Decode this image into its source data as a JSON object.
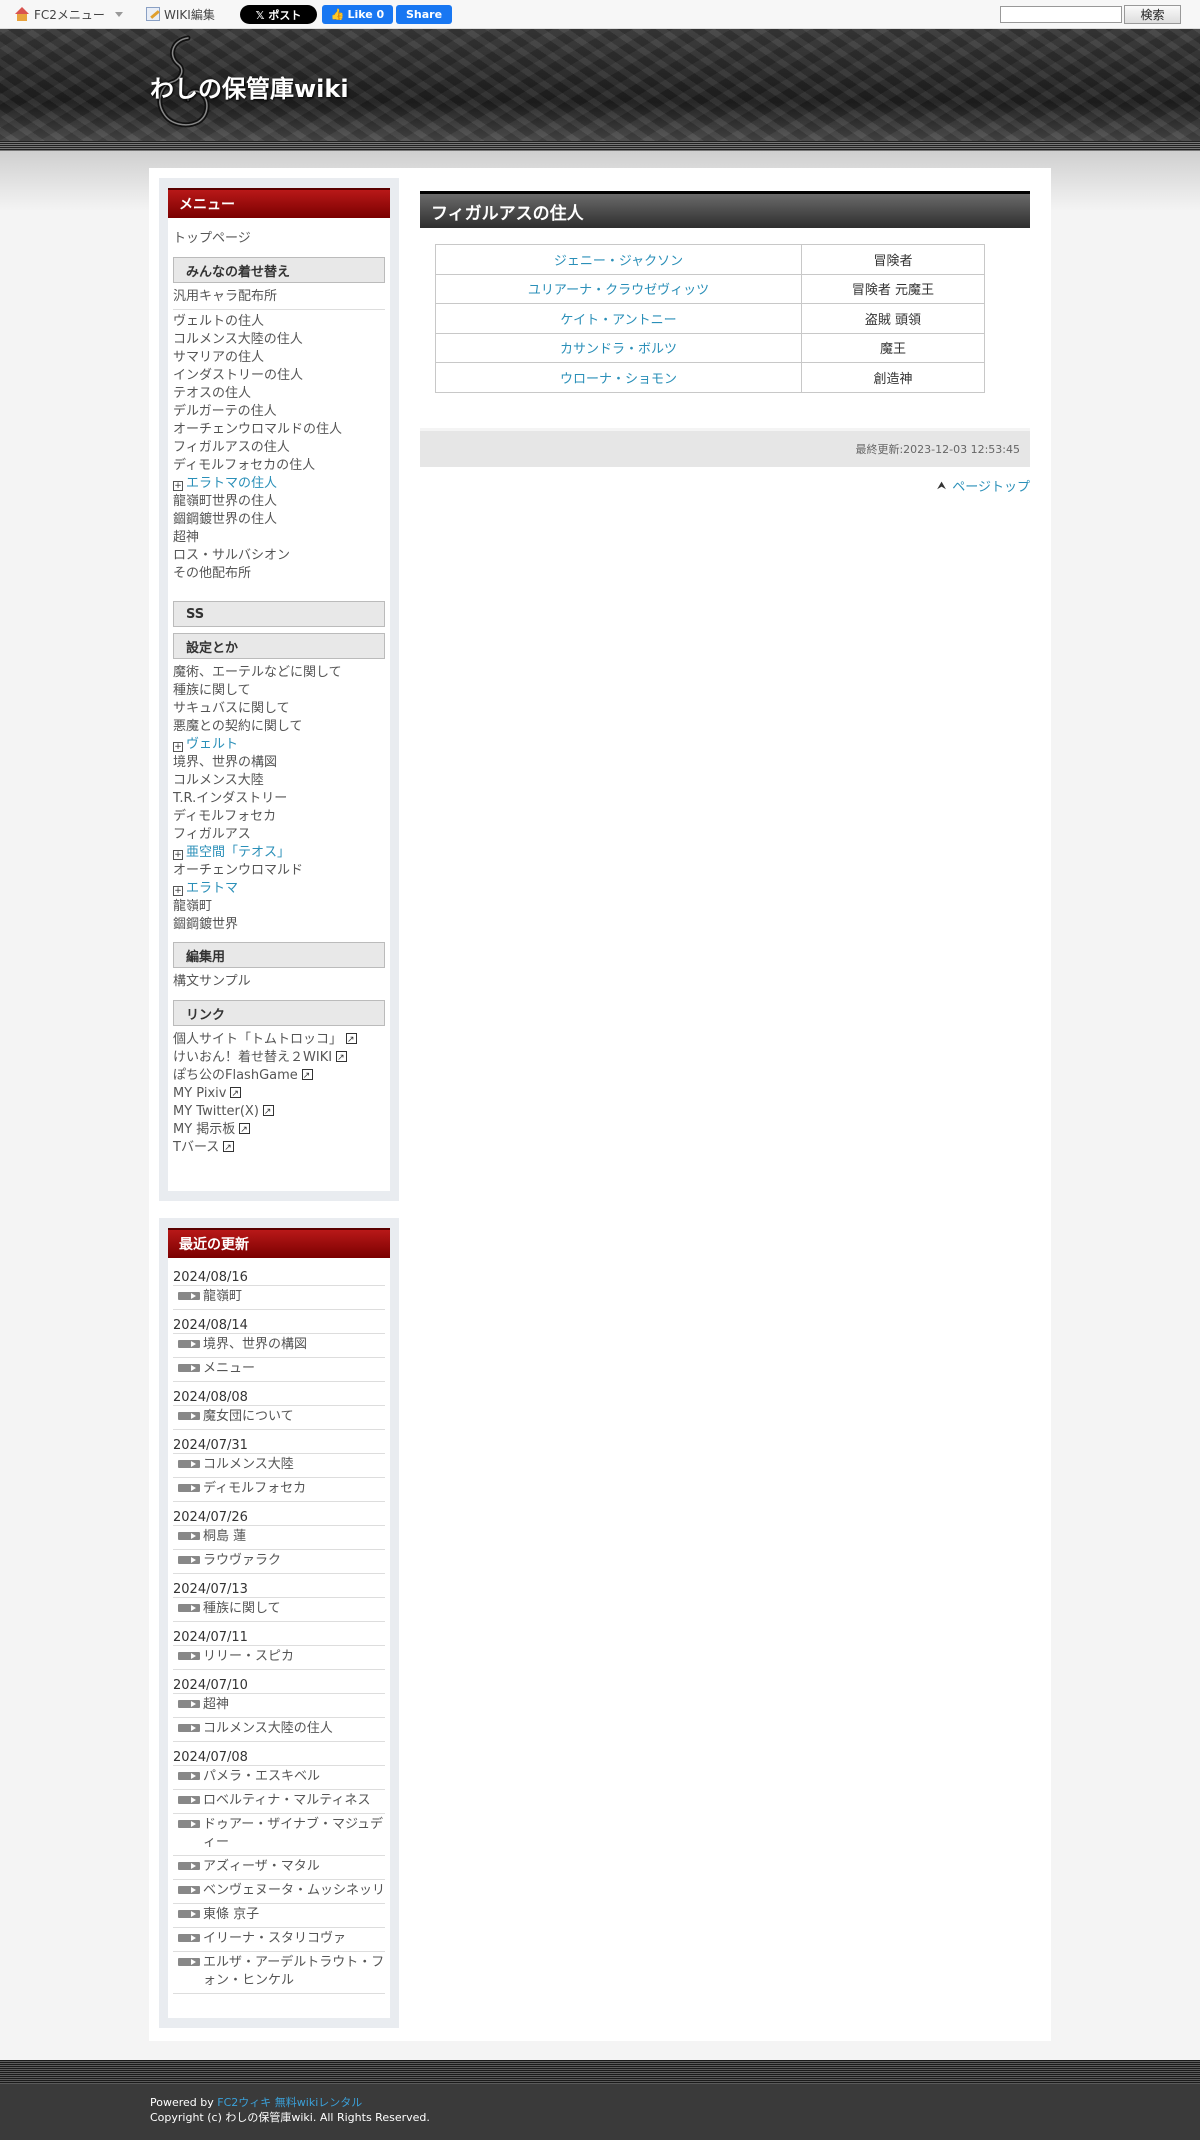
{
  "topbar": {
    "fc2_menu": "FC2メニュー",
    "wiki_edit": "WIKI編集",
    "post": "𝕏 ポスト",
    "like": "Like 0",
    "share": "Share",
    "search_button": "検索",
    "search_value": ""
  },
  "header": {
    "title": "わしの保管庫wiki"
  },
  "sidebar": {
    "menu_heading": "メニュー",
    "top_page": "トップページ",
    "sections": [
      {
        "title": "みんなの着せ替え",
        "top_items": [
          "汎用キャラ配布所"
        ],
        "items": [
          {
            "label": "ヴェルトの住人",
            "expand": false
          },
          {
            "label": "コルメンス大陸の住人",
            "expand": false
          },
          {
            "label": "サマリアの住人",
            "expand": false
          },
          {
            "label": "インダストリーの住人",
            "expand": false
          },
          {
            "label": "テオスの住人",
            "expand": false
          },
          {
            "label": "デルガーテの住人",
            "expand": false
          },
          {
            "label": "オーチェンウロマルドの住人",
            "expand": false
          },
          {
            "label": "フィガルアスの住人",
            "expand": false
          },
          {
            "label": "ディモルフォセカの住人",
            "expand": false
          },
          {
            "label": "エラトマの住人",
            "expand": true
          },
          {
            "label": "龍嶺町世界の住人",
            "expand": false
          },
          {
            "label": "錮鋼鍍世界の住人",
            "expand": false
          },
          {
            "label": "超神",
            "expand": false
          },
          {
            "label": "ロス・サルバシオン",
            "expand": false
          },
          {
            "label": "その他配布所",
            "expand": false
          }
        ]
      }
    ],
    "ss_heading": "SS",
    "settings_heading": "設定とか",
    "settings_items": [
      {
        "label": "魔術、エーテルなどに関して",
        "expand": false
      },
      {
        "label": "種族に関して",
        "expand": false
      },
      {
        "label": "サキュバスに関して",
        "expand": false
      },
      {
        "label": "悪魔との契約に関して",
        "expand": false
      },
      {
        "label": "ヴェルト",
        "expand": true
      },
      {
        "label": "境界、世界の構図",
        "expand": false
      },
      {
        "label": "コルメンス大陸",
        "expand": false
      },
      {
        "label": "T.R.インダストリー",
        "expand": false
      },
      {
        "label": "ディモルフォセカ",
        "expand": false
      },
      {
        "label": "フィガルアス",
        "expand": false
      },
      {
        "label": "亜空間「テオス」",
        "expand": true
      },
      {
        "label": "オーチェンウロマルド",
        "expand": false
      },
      {
        "label": "エラトマ",
        "expand": true
      },
      {
        "label": "龍嶺町",
        "expand": false
      },
      {
        "label": "錮鋼鍍世界",
        "expand": false
      }
    ],
    "edit_heading": "編集用",
    "edit_items": [
      "構文サンプル"
    ],
    "links_heading": "リンク",
    "links": [
      "個人サイト「トムトロッコ」",
      "けいおん！着せ替え２WIKI",
      "ぽち公のFlashGame",
      "MY Pixiv",
      "MY Twitter(X)",
      "MY 掲示板",
      "Tバース"
    ],
    "recent_heading": "最近の更新",
    "recent": [
      {
        "date": "2024/08/16",
        "items": [
          "龍嶺町"
        ]
      },
      {
        "date": "2024/08/14",
        "items": [
          "境界、世界の構図",
          "メニュー"
        ]
      },
      {
        "date": "2024/08/08",
        "items": [
          "魔女団について"
        ]
      },
      {
        "date": "2024/07/31",
        "items": [
          "コルメンス大陸",
          "ディモルフォセカ"
        ]
      },
      {
        "date": "2024/07/26",
        "items": [
          "桐島 蓮",
          "ラウヴァラク"
        ]
      },
      {
        "date": "2024/07/13",
        "items": [
          "種族に関して"
        ]
      },
      {
        "date": "2024/07/11",
        "items": [
          "リリー・スピカ"
        ]
      },
      {
        "date": "2024/07/10",
        "items": [
          "超神",
          "コルメンス大陸の住人"
        ]
      },
      {
        "date": "2024/07/08",
        "items": [
          "パメラ・エスキベル",
          "ロベルティナ・マルティネス",
          "ドゥアー・ザイナブ・マジュディー",
          "アズィーザ・マタル",
          "ベンヴェヌータ・ムッシネッリ",
          "東條 京子",
          "イリーナ・スタリコヴァ",
          "エルザ・アーデルトラウト・フォン・ヒンケル"
        ]
      }
    ]
  },
  "main": {
    "title": "フィガルアスの住人",
    "table": [
      {
        "name": "ジェニー・ジャクソン",
        "role": "冒険者"
      },
      {
        "name": "ユリアーナ・クラウゼヴィッツ",
        "role": "冒険者 元魔王"
      },
      {
        "name": "ケイト・アントニー",
        "role": "盗賊 頭領"
      },
      {
        "name": "カサンドラ・ボルツ",
        "role": "魔王"
      },
      {
        "name": "ウローナ・ショモン",
        "role": "創造神"
      }
    ],
    "last_updated": "最終更新:2023-12-03 12:53:45",
    "page_top": "ページトップ"
  },
  "footer": {
    "powered_prefix": "Powered by ",
    "powered_link": "FC2ウィキ 無料wikiレンタル",
    "copyright": "Copyright (c) わしの保管庫wiki. All Rights Reserved."
  },
  "colors": {
    "link": "#2a8fb8",
    "heading_red": "#9a0000",
    "header_dark": "#2b2b2b"
  }
}
